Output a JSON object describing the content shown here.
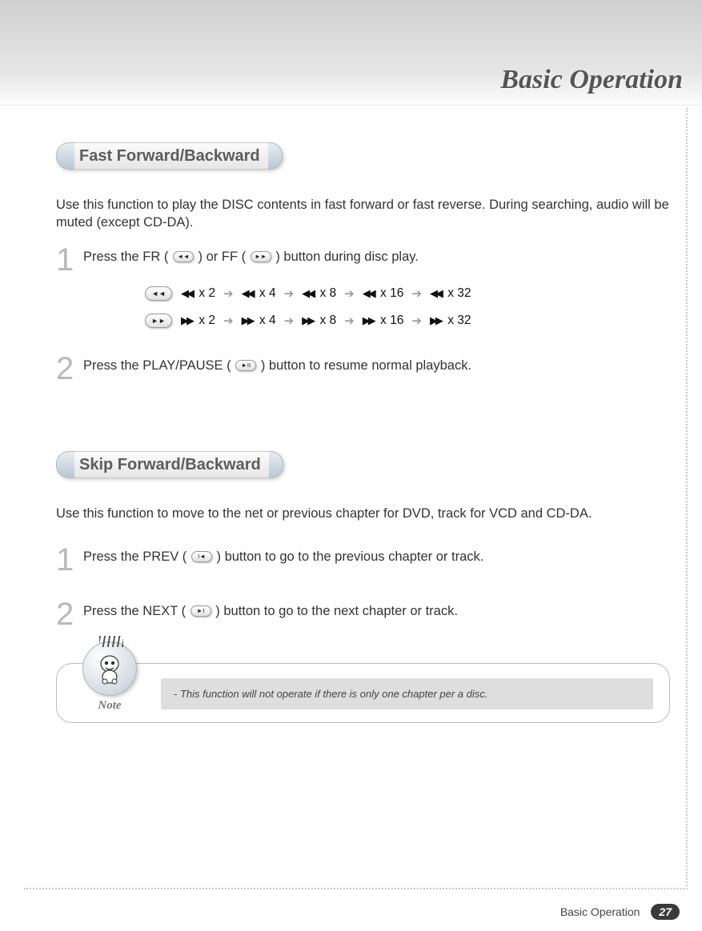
{
  "page_title": "Basic Operation",
  "footer_label": "Basic Operation",
  "page_number": "27",
  "sections": {
    "fast": {
      "heading": "Fast Forward/Backward",
      "intro": "Use this function to play the DISC contents in fast forward or fast reverse. During searching, audio will be muted (except CD-DA).",
      "step1_a": "Press the FR (",
      "step1_b": ") or FF (",
      "step1_c": ") button during disc play.",
      "step2_a": "Press the PLAY/PAUSE (",
      "step2_b": ") button to resume normal playback.",
      "rev_speeds": [
        "x 2",
        "x 4",
        "x 8",
        "x 16",
        "x 32"
      ],
      "fwd_speeds": [
        "x 2",
        "x 4",
        "x 8",
        "x 16",
        "x 32"
      ]
    },
    "skip": {
      "heading": "Skip Forward/Backward",
      "intro": "Use this function to move to the net or previous chapter for DVD, track for VCD and CD-DA.",
      "step1_a": "Press the PREV (",
      "step1_b": ") button to go to the previous chapter or track.",
      "step2_a": "Press the NEXT (",
      "step2_b": ") button to go to the next chapter or track."
    }
  },
  "note": {
    "label": "Note",
    "text": "-  This function will not operate if there is only one chapter per a disc."
  },
  "icons": {
    "rewind": "◄◄",
    "forward": "►►",
    "prev": "I◄",
    "next": "►I",
    "playpause": "►II",
    "arrow": "➔",
    "rev_tri": "◀◀",
    "fwd_tri": "▶▶"
  }
}
